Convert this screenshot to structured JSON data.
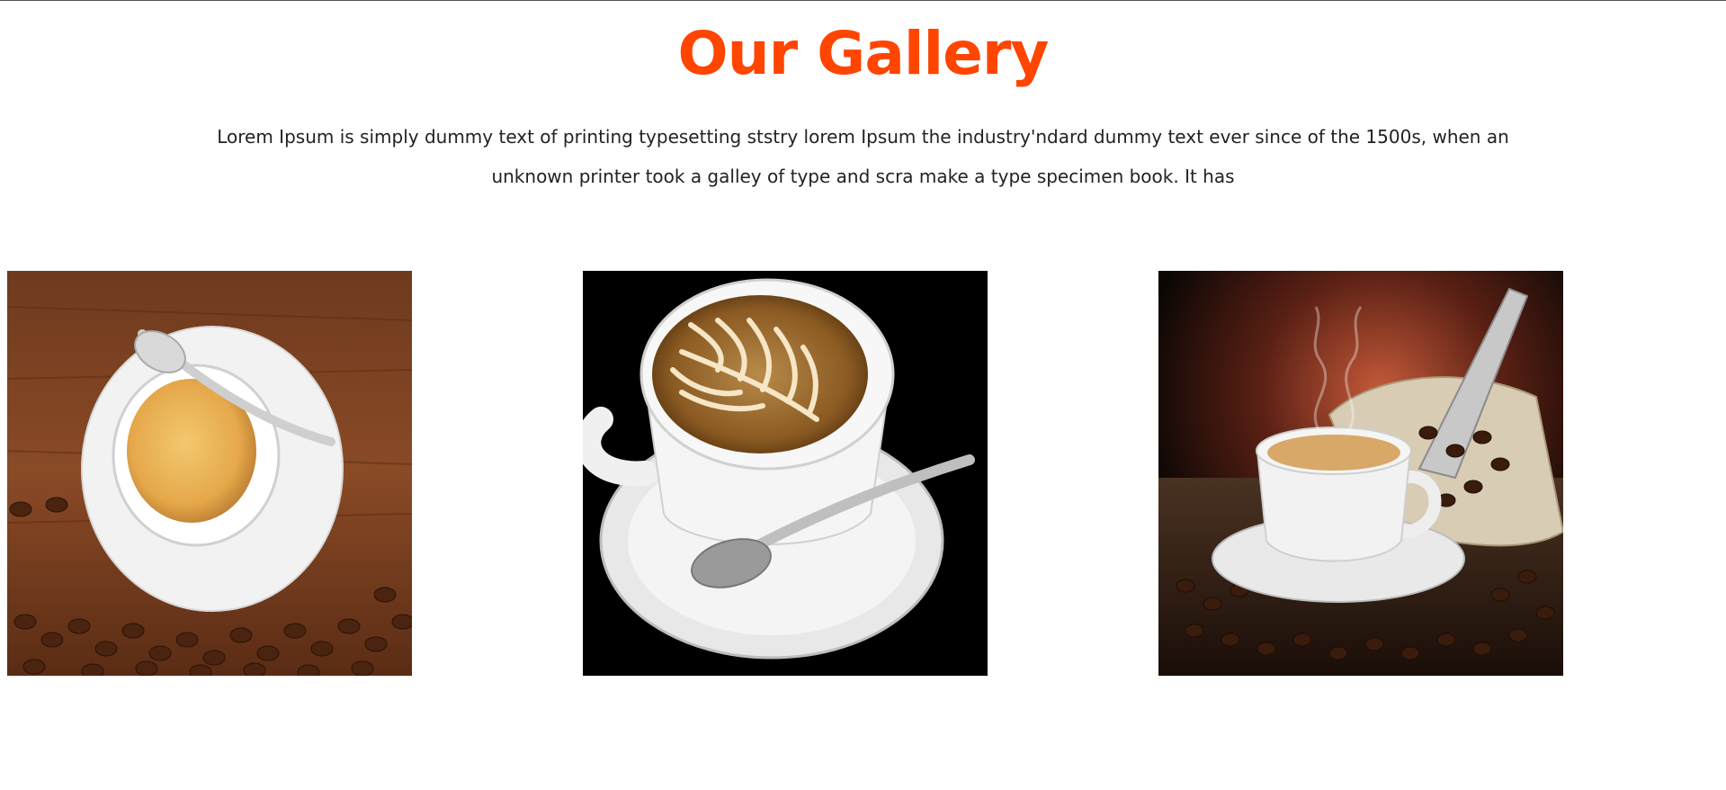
{
  "gallery": {
    "title": "Our Gallery",
    "description": "Lorem Ipsum is simply dummy text of printing typesetting ststry lorem Ipsum the industry'ndard dummy text ever since of the 1500s, when an unknown printer took a galley of type and scra make a type specimen book. It has",
    "accent_color": "#ff4500",
    "images": [
      {
        "subject": "espresso-cup-on-wood-with-beans-image"
      },
      {
        "subject": "latte-art-cup-on-black-image"
      },
      {
        "subject": "coffee-cup-with-beans-sack-and-scoop-image"
      }
    ]
  }
}
